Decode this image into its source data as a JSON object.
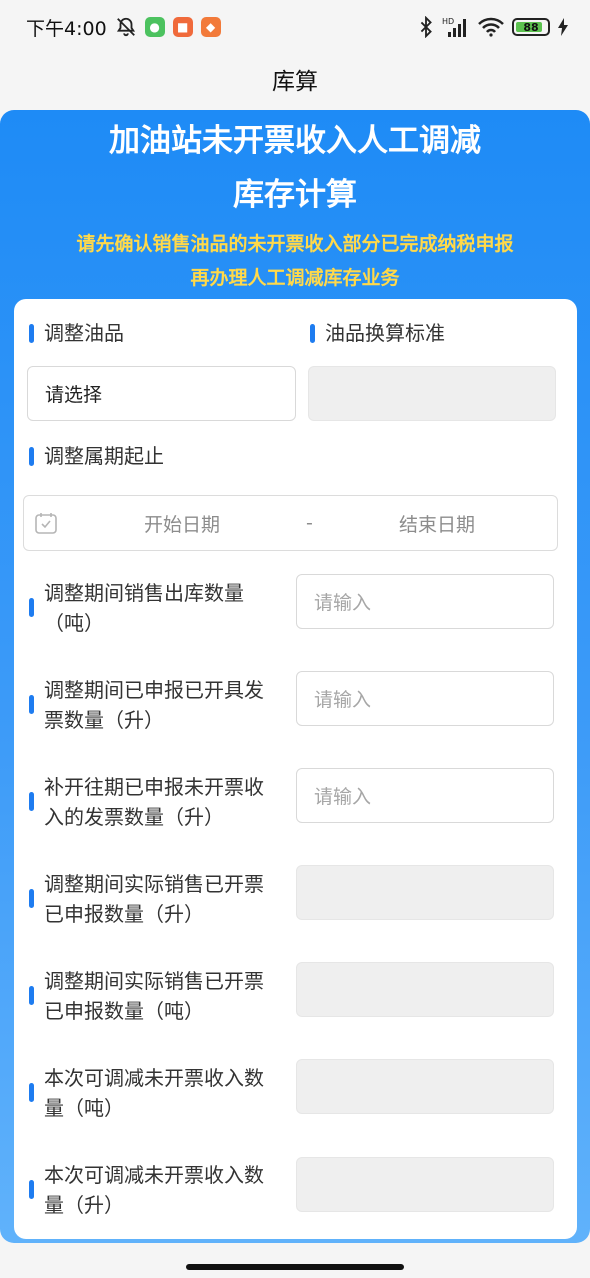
{
  "status_bar": {
    "time": "下午4:00",
    "battery": "88",
    "battery_level": 0.88,
    "icons_left": [
      "mute-bell-icon",
      "wechat-icon",
      "app-icon",
      "taobao-icon"
    ],
    "icons_right": [
      "bluetooth-icon",
      "signal-icon",
      "wifi-icon",
      "battery-icon",
      "charging-icon"
    ],
    "hd_label": "HD"
  },
  "nav": {
    "title": "库算"
  },
  "hero": {
    "title_line1": "加油站未开票收入人工调减",
    "title_line2": "库存计算",
    "notice_line1": "请先确认销售油品的未开票收入部分已完成纳税申报",
    "notice_line2": "再办理人工调减库存业务"
  },
  "form": {
    "oil_label": "调整油品",
    "oil_select_value": "请选择",
    "conversion_label": "油品换算标准",
    "conversion_value": "",
    "period_label": "调整属期起止",
    "date_start_placeholder": "开始日期",
    "date_separator": "-",
    "date_end_placeholder": "结束日期",
    "fields": [
      {
        "label_line1": "调整期间销售出库数量",
        "label_line2": "（吨）",
        "placeholder": "请输入",
        "editable": true
      },
      {
        "label_line1": "调整期间已申报已开具发",
        "label_line2": "票数量（升）",
        "placeholder": "请输入",
        "editable": true
      },
      {
        "label_line1": "补开往期已申报未开票收",
        "label_line2": "入的发票数量（升）",
        "placeholder": "请输入",
        "editable": true
      },
      {
        "label_line1": "调整期间实际销售已开票",
        "label_line2": "已申报数量（升）",
        "placeholder": "",
        "editable": false
      },
      {
        "label_line1": "调整期间实际销售已开票",
        "label_line2": "已申报数量（吨）",
        "placeholder": "",
        "editable": false
      },
      {
        "label_line1": "本次可调减未开票收入数",
        "label_line2": "量（吨）",
        "placeholder": "",
        "editable": false
      },
      {
        "label_line1": "本次可调减未开票收入数",
        "label_line2": "量（升）",
        "placeholder": "",
        "editable": false
      }
    ]
  },
  "colors": {
    "primary_blue": "#1e8bf6",
    "notice_yellow": "#ffd94a",
    "accent_bar": "#1e7cf0"
  }
}
